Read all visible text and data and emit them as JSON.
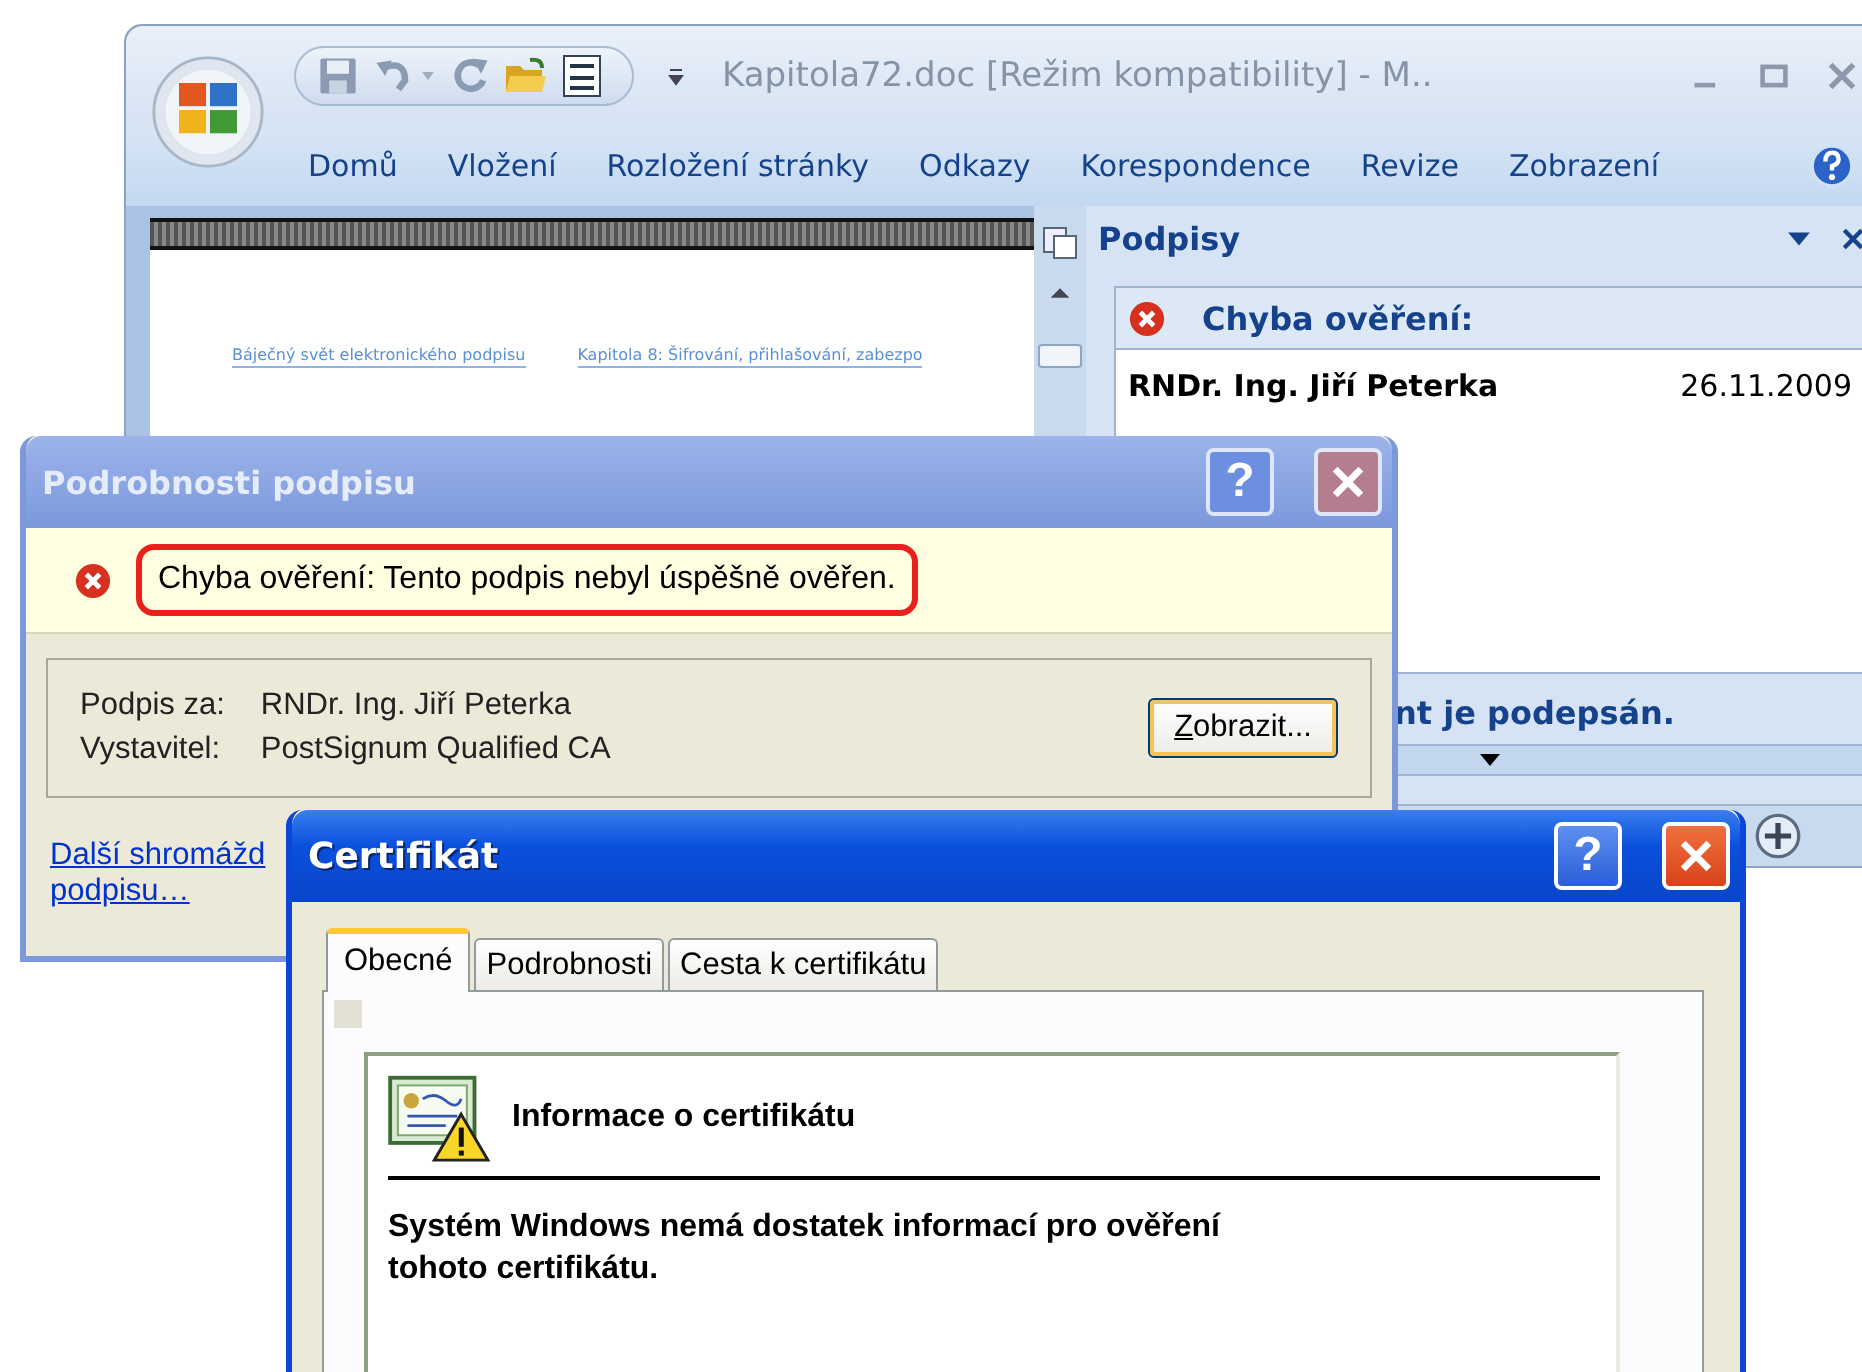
{
  "word_window": {
    "title": "Kapitola72.doc [Režim kompatibility] - M..",
    "ribbon_tabs": [
      "Domů",
      "Vložení",
      "Rozložení stránky",
      "Odkazy",
      "Korespondence",
      "Revize",
      "Zobrazení"
    ],
    "document": {
      "header_left": "Báječný svět elektronického podpisu",
      "header_right": "Kapitola 8: Šifrování, přihlašování, zabezpo"
    },
    "signatures_pane": {
      "title": "Podpisy",
      "error_heading": "Chyba ověření:",
      "signer": "RNDr. Ing. Jiří Peterka",
      "date": "26.11.2009",
      "footer": "nt je podepsán."
    }
  },
  "signature_details_dialog": {
    "title": "Podrobnosti podpisu",
    "help_button": "?",
    "error_message": "Chyba ověření: Tento podpis nebyl úspěšně ověřen.",
    "fields": [
      {
        "label": "Podpis za:",
        "value": "RNDr. Ing. Jiří Peterka"
      },
      {
        "label": "Vystavitel:",
        "value": "PostSignum Qualified CA"
      }
    ],
    "view_button": "Zobrazit...",
    "link_lines": [
      "Další shromážd",
      "podpisu…"
    ]
  },
  "certificate_dialog": {
    "title": "Certifikát",
    "help_button": "?",
    "tabs": [
      {
        "label": "Obecné",
        "selected": true
      },
      {
        "label": "Podrobnosti",
        "selected": false
      },
      {
        "label": "Cesta k certifikátu",
        "selected": false
      }
    ],
    "info_heading": "Informace o certifikátu",
    "message": "Systém Windows nemá dostatek informací pro ověření tohoto certifikátu."
  }
}
